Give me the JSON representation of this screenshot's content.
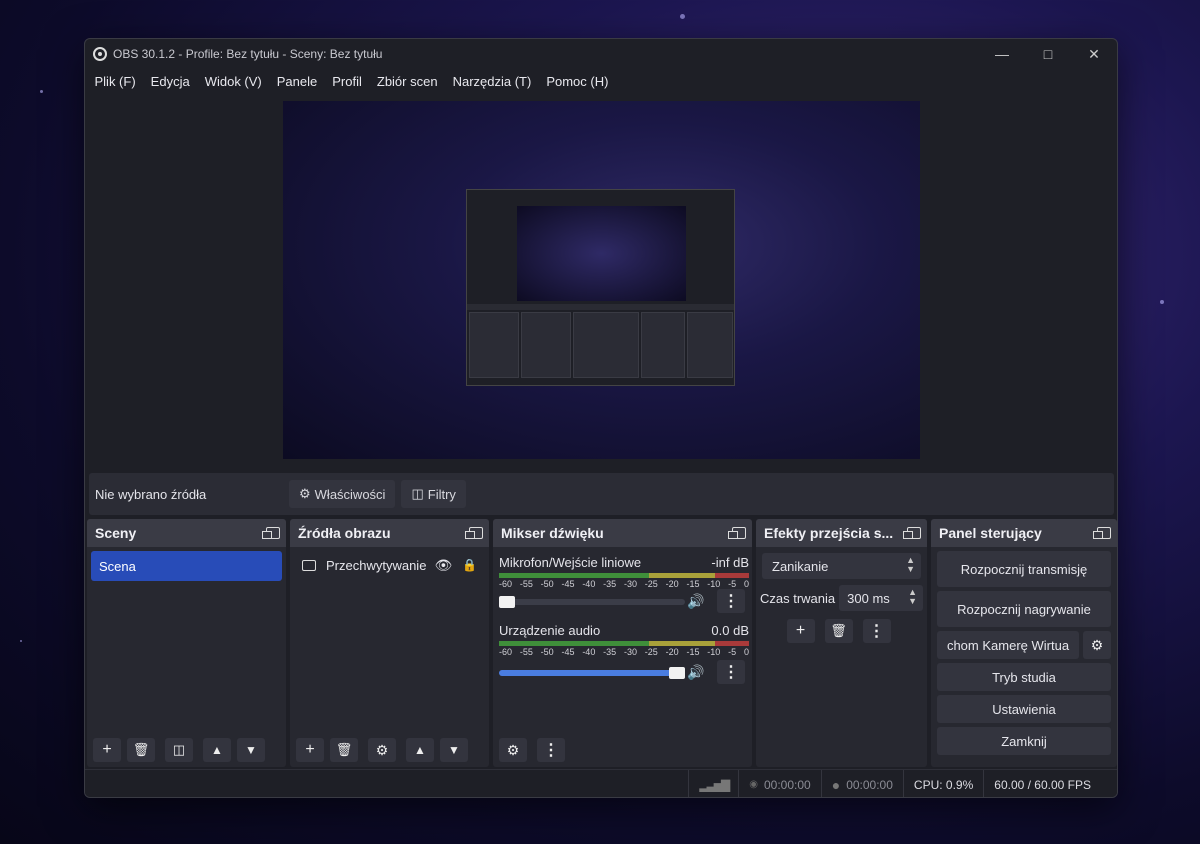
{
  "window": {
    "title": "OBS 30.1.2 - Profile: Bez tytułu - Sceny: Bez tytułu"
  },
  "menu": [
    "Plik (F)",
    "Edycja",
    "Widok (V)",
    "Panele",
    "Profil",
    "Zbiór scen",
    "Narzędzia (T)",
    "Pomoc (H)"
  ],
  "infobar": {
    "no_source": "Nie wybrano źródła",
    "properties": "Właściwości",
    "filters": "Filtry"
  },
  "scenes": {
    "title": "Sceny",
    "items": [
      "Scena"
    ]
  },
  "sources": {
    "title": "Źródła obrazu",
    "items": [
      "Przechwytywanie"
    ]
  },
  "mixer": {
    "title": "Mikser dźwięku",
    "channels": [
      {
        "name": "Mikrofon/Wejście liniowe",
        "level": "-inf dB",
        "volume_fraction": 0.0
      },
      {
        "name": "Urządzenie audio",
        "level": "0.0 dB",
        "volume_fraction": 1.0
      }
    ],
    "scale": [
      "-60",
      "-55",
      "-50",
      "-45",
      "-40",
      "-35",
      "-30",
      "-25",
      "-20",
      "-15",
      "-10",
      "-5",
      "0"
    ]
  },
  "transitions": {
    "title": "Efekty przejścia s...",
    "selected": "Zanikanie",
    "duration_label": "Czas trwania",
    "duration_value": "300 ms"
  },
  "controls": {
    "title": "Panel sterujący",
    "start_stream": "Rozpocznij transmisję",
    "start_record": "Rozpocznij nagrywanie",
    "virtual_cam": "chom Kamerę Wirtua",
    "studio_mode": "Tryb studia",
    "settings": "Ustawienia",
    "exit": "Zamknij"
  },
  "status": {
    "rec_time": "00:00:00",
    "stream_time": "00:00:00",
    "cpu": "CPU: 0.9%",
    "fps": "60.00 / 60.00 FPS"
  },
  "colors": {
    "accent": "#284cb8",
    "meter_green": "#3f8f3a",
    "meter_yellow": "#a9a13a",
    "meter_red": "#a83a3a"
  }
}
